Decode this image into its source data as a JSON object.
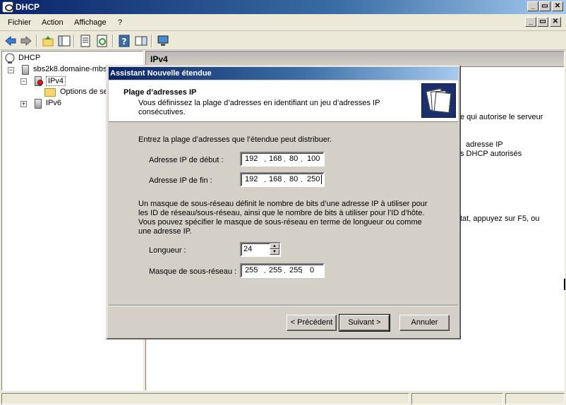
{
  "window": {
    "title": "DHCP"
  },
  "window_buttons": [
    "_",
    "▭",
    "✕"
  ],
  "menu": {
    "items": [
      "Fichier",
      "Action",
      "Affichage",
      "?"
    ]
  },
  "tree": {
    "root": "DHCP",
    "server": "sbs2k8.domaine-mbs.",
    "ipv4": "IPv4",
    "options": "Options de se",
    "ipv6": "IPv6"
  },
  "right_pane": {
    "header": "IPv4",
    "text_1": "e qui autorise le serveur",
    "text_2": "adresse IP",
    "text_3": "s DHCP autorisés",
    "text_4": "tat, appuyez sur F5, ou"
  },
  "dialog": {
    "title": "Assistant Nouvelle étendue",
    "header_title": "Plage d’adresses IP",
    "header_desc": "Vous définissez la plage d’adresses en identifiant un jeu d’adresses IP consécutives.",
    "range_intro": "Entrez la plage d’adresses que l’étendue peut distribuer.",
    "start_label": "Adresse IP de début :",
    "start_ip": [
      "192",
      "168",
      "80",
      "100"
    ],
    "end_label": "Adresse IP de fin :",
    "end_ip": [
      "192",
      "168",
      "80",
      "250"
    ],
    "mask_paragraph": "Un masque de sous-réseau définit le nombre de bits d’une adresse IP à utiliser pour les ID de réseau/sous-réseau, ainsi que le nombre de bits à utiliser pour l’ID d’hôte. Vous pouvez spécifier le masque de sous-réseau en terme de longueur ou comme une adresse IP.",
    "length_label": "Longueur :",
    "length_value": "24",
    "mask_label": "Masque de sous-réseau :",
    "mask_ip": [
      "255",
      "255",
      "255",
      "0"
    ],
    "ip_separator": ".",
    "buttons": {
      "back": "< Précédent",
      "next": "Suivant >",
      "cancel": "Annuler"
    }
  },
  "colors": {
    "title_bar": "#0a246a",
    "dialog_face": "#d4d0c8",
    "folder": "#f5d66a"
  }
}
